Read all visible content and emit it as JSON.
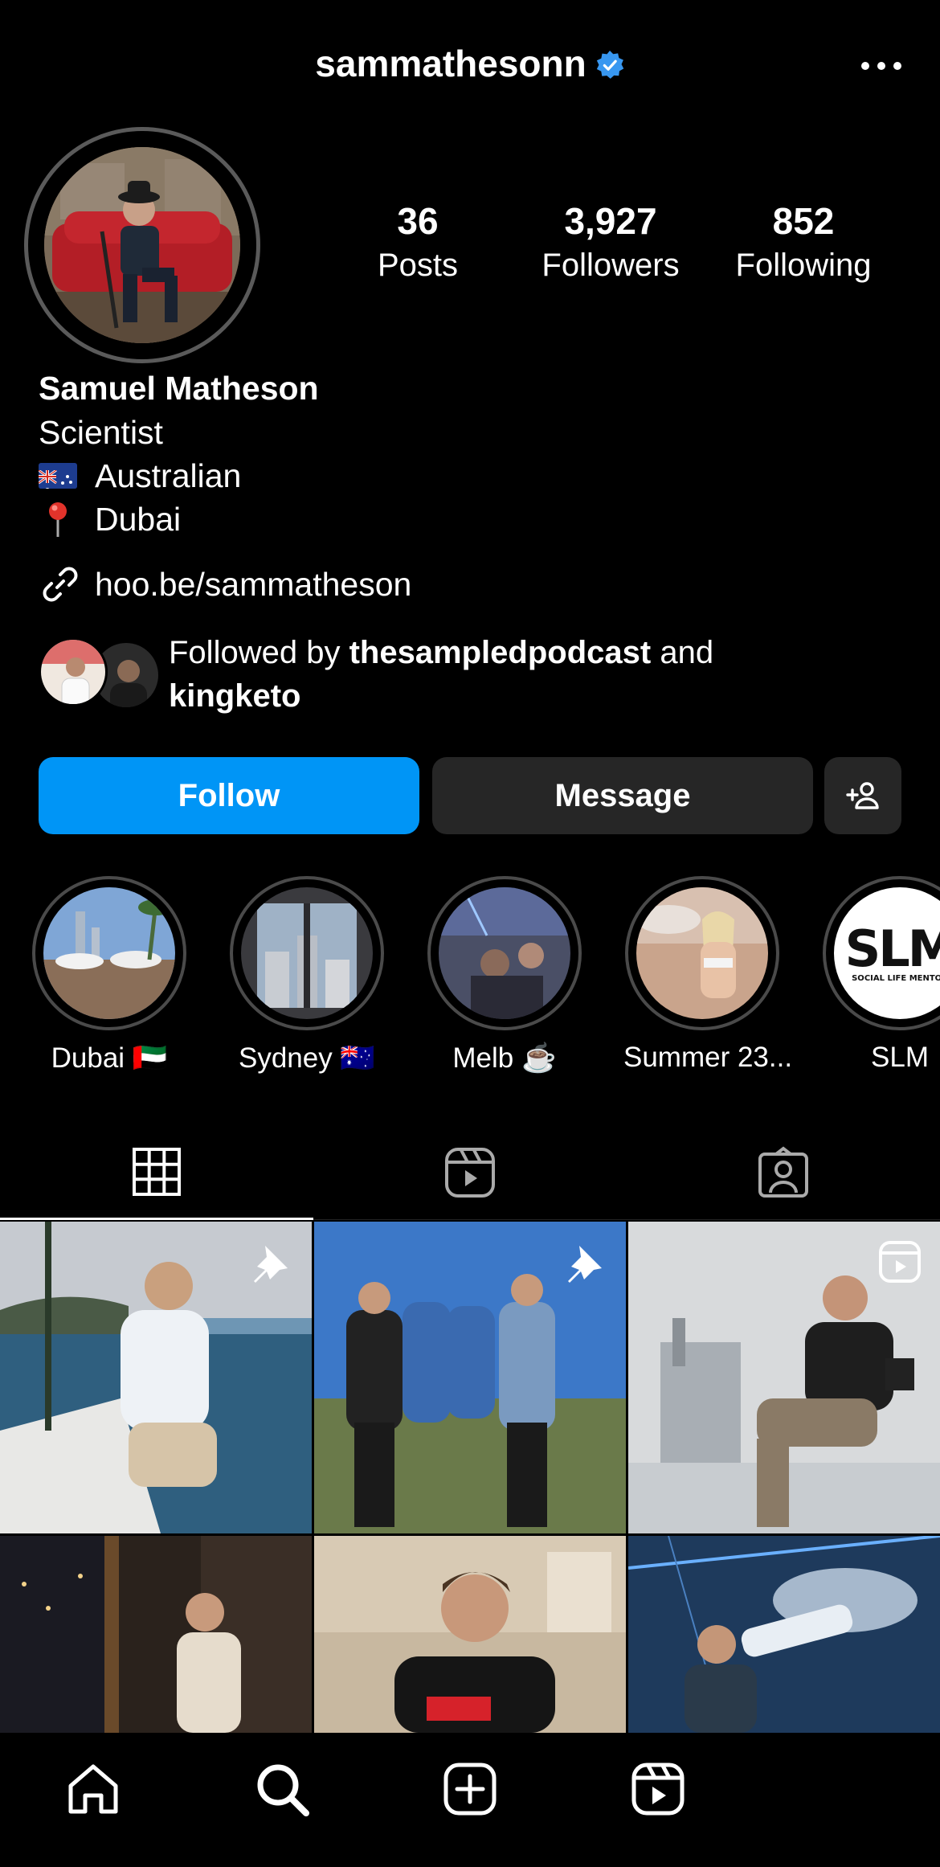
{
  "header": {
    "username": "sammathesonn",
    "verified_icon": "verified-badge-icon",
    "more_icon": "more-options-icon"
  },
  "profile": {
    "avatar_alt": "Samuel Matheson profile photo",
    "stats": [
      {
        "value": "36",
        "label": "Posts"
      },
      {
        "value": "3,927",
        "label": "Followers"
      },
      {
        "value": "852",
        "label": "Following"
      }
    ],
    "name": "Samuel Matheson",
    "bio_lines": [
      "Scientist",
      "Australian",
      "Dubai"
    ],
    "bio_flag_icon": "australia-flag-icon",
    "bio_pin_icon": "round-pushpin-icon",
    "link": "hoo.be/sammatheson",
    "followed_by": {
      "prefix": "Followed by ",
      "user1": "thesampledpodcast",
      "middle": " and",
      "user2": "kingketo"
    }
  },
  "actions": {
    "follow": "Follow",
    "message": "Message",
    "add_user_icon": "add-user-icon"
  },
  "highlights": [
    {
      "label": "Dubai 🇦🇪"
    },
    {
      "label": "Sydney 🇦🇺"
    },
    {
      "label": "Melb ☕️"
    },
    {
      "label": "Summer 23..."
    },
    {
      "label": "SLM",
      "logo_text": "SLM",
      "logo_sub": "SOCIAL LIFE MENTOR"
    }
  ],
  "tabs": [
    "grid-icon",
    "reels-icon",
    "tagged-icon"
  ],
  "grid": [
    {
      "badge": "pin-icon"
    },
    {
      "badge": "pin-icon"
    },
    {
      "badge": "reel-icon"
    },
    {
      "badge": ""
    },
    {
      "badge": ""
    },
    {
      "badge": ""
    }
  ],
  "bottom_nav": [
    "home-icon",
    "search-icon",
    "create-icon",
    "reels-icon"
  ],
  "colors": {
    "accent": "#0095f6",
    "button_dark": "#262626",
    "verified": "#3897f0"
  }
}
